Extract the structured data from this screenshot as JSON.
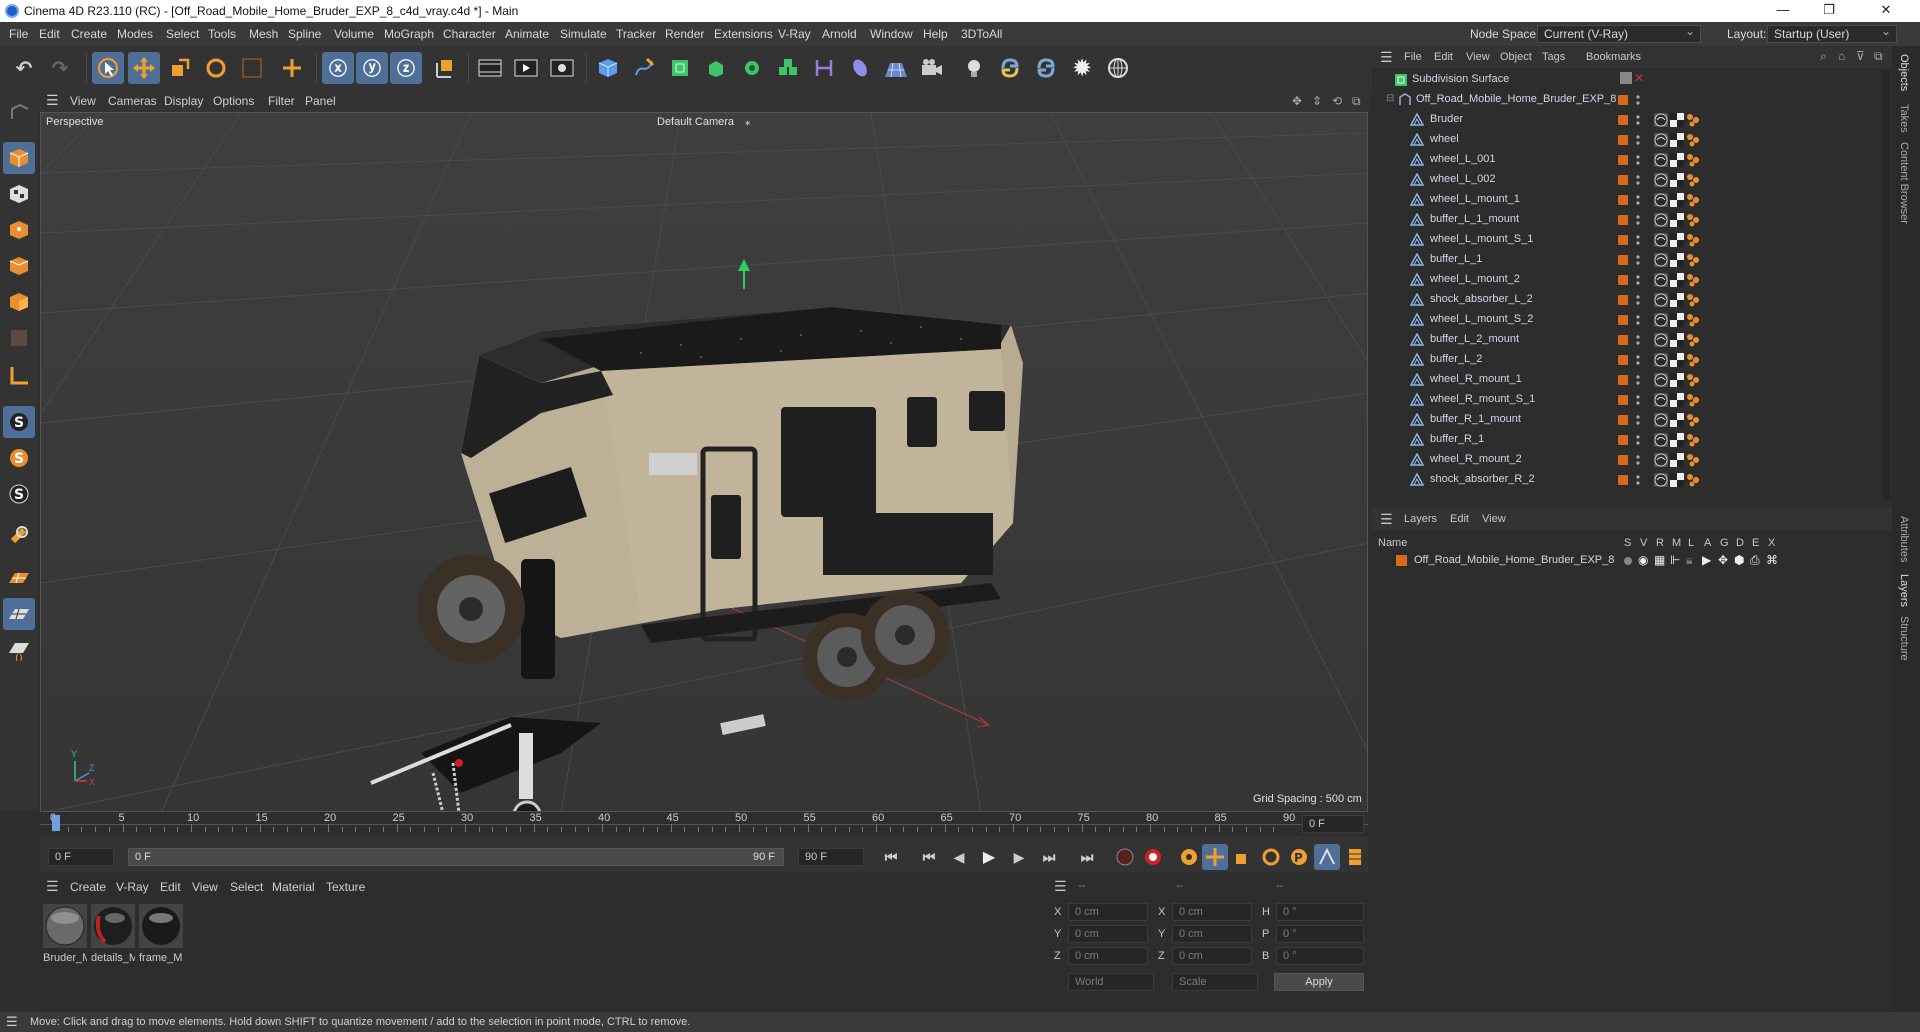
{
  "window": {
    "title": "Cinema 4D R23.110 (RC) - [Off_Road_Mobile_Home_Bruder_EXP_8_c4d_vray.c4d *] - Main",
    "minimize": "—",
    "maximize": "❐",
    "close": "✕"
  },
  "menubar": {
    "items": [
      "File",
      "Edit",
      "Create",
      "Modes",
      "Select",
      "Tools",
      "Mesh",
      "Spline",
      "Volume",
      "MoGraph",
      "Character",
      "Animate",
      "Simulate",
      "Tracker",
      "Render",
      "Extensions",
      "V-Ray",
      "Arnold",
      "Window",
      "Help",
      "3DToAll"
    ],
    "node_space_label": "Node Space:",
    "node_space_value": "Current (V-Ray)",
    "layout_label": "Layout:",
    "layout_value": "Startup (User)"
  },
  "viewport": {
    "menu": [
      "View",
      "Cameras",
      "Display",
      "Options",
      "Filter",
      "Panel"
    ],
    "projection": "Perspective",
    "camera": "Default Camera",
    "grid_spacing": "Grid Spacing : 500 cm",
    "axis_y": "Y",
    "axis_z": "Z",
    "axis_x": "X"
  },
  "timeline": {
    "ticks": [
      "0",
      "5",
      "10",
      "15",
      "20",
      "25",
      "30",
      "35",
      "40",
      "45",
      "50",
      "55",
      "60",
      "65",
      "70",
      "75",
      "80",
      "85",
      "90"
    ],
    "current_frame": "0 F",
    "start_frame": "0 F",
    "range_start": "0 F",
    "range_end": "90 F",
    "end_frame": "90 F"
  },
  "materials": {
    "menu": [
      "Create",
      "V-Ray",
      "Edit",
      "View",
      "Select",
      "Material",
      "Texture"
    ],
    "items": [
      {
        "label": "Bruder_M"
      },
      {
        "label": "details_M"
      },
      {
        "label": "frame_M"
      }
    ]
  },
  "coords": {
    "header": [
      "--",
      "--",
      "--"
    ],
    "rows": [
      {
        "a": "X",
        "av": "0 cm",
        "b": "X",
        "bv": "0 cm",
        "c": "H",
        "cv": "0 °"
      },
      {
        "a": "Y",
        "av": "0 cm",
        "b": "Y",
        "bv": "0 cm",
        "c": "P",
        "cv": "0 °"
      },
      {
        "a": "Z",
        "av": "0 cm",
        "b": "Z",
        "bv": "0 cm",
        "c": "B",
        "cv": "0 °"
      }
    ],
    "space": "World",
    "mode": "Scale",
    "apply": "Apply"
  },
  "objects": {
    "menu": [
      "File",
      "Edit",
      "View",
      "Object",
      "Tags",
      "Bookmarks"
    ],
    "root": "Subdivision Surface",
    "group": "Off_Road_Mobile_Home_Bruder_EXP_8",
    "items": [
      "Bruder",
      "wheel",
      "wheel_L_001",
      "wheel_L_002",
      "wheel_L_mount_1",
      "buffer_L_1_mount",
      "wheel_L_mount_S_1",
      "buffer_L_1",
      "wheel_L_mount_2",
      "shock_absorber_L_2",
      "wheel_L_mount_S_2",
      "buffer_L_2_mount",
      "buffer_L_2",
      "wheel_R_mount_1",
      "wheel_R_mount_S_1",
      "buffer_R_1_mount",
      "buffer_R_1",
      "wheel_R_mount_2",
      "shock_absorber_R_2"
    ]
  },
  "layers": {
    "menu": [
      "Layers",
      "Edit",
      "View"
    ],
    "col_name": "Name",
    "cols": [
      "S",
      "V",
      "R",
      "M",
      "L",
      "A",
      "G",
      "D",
      "E",
      "X"
    ],
    "rows": [
      {
        "name": "Off_Road_Mobile_Home_Bruder_EXP_8"
      }
    ]
  },
  "right_tabs": [
    "Objects",
    "Takes",
    "Content Browser",
    "Attributes",
    "Layers",
    "Structure"
  ],
  "status": "Move: Click and drag to move elements. Hold down SHIFT to quantize movement / add to the selection in point mode, CTRL to remove.",
  "colors": {
    "accent": "#4f6f98",
    "orange": "#d86a1e",
    "timeline_marker": "#6fa0e0"
  }
}
